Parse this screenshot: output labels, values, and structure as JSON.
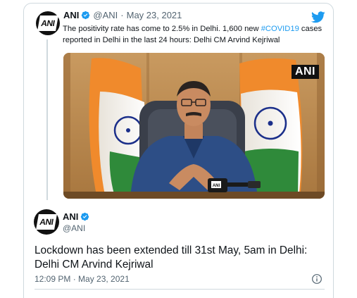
{
  "quoted_tweet": {
    "name": "ANI",
    "handle": "@ANI",
    "separator": "·",
    "date": "May 23, 2021",
    "text_before": "The positivity rate has come to 2.5% in Delhi. 1,600 new ",
    "hashtag": "#COVID19",
    "text_after": " cases reported in Delhi in the last 24 hours: Delhi CM Arvind Kejriwal",
    "media_watermark": "ANI"
  },
  "main_tweet": {
    "name": "ANI",
    "handle": "@ANI",
    "text": "Lockdown has been extended till 31st May, 5am in Delhi: Delhi CM Arvind Kejriwal",
    "timestamp": "12:09 PM · May 23, 2021"
  },
  "colors": {
    "accent": "#1d9bf0",
    "secondary_text": "#536471",
    "border": "#cfd9de"
  },
  "icons": [
    "verified-badge-icon",
    "twitter-bird-icon",
    "info-icon"
  ]
}
